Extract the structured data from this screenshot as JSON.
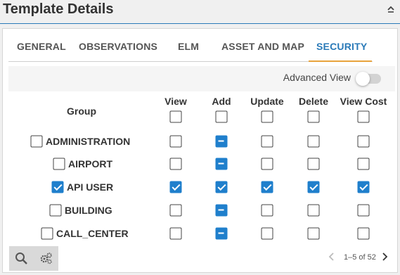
{
  "header": {
    "title": "Template Details",
    "collapse_icon": "chevron-up-icon"
  },
  "tabs": [
    {
      "label": "GENERAL",
      "active": false
    },
    {
      "label": "OBSERVATIONS",
      "active": false
    },
    {
      "label": "ELM",
      "active": false
    },
    {
      "label": "ASSET AND MAP",
      "active": false
    },
    {
      "label": "SECURITY",
      "active": true
    }
  ],
  "advanced_view": {
    "label": "Advanced View",
    "enabled": false
  },
  "table": {
    "group_header": "Group",
    "columns": [
      "View",
      "Add",
      "Update",
      "Delete",
      "View Cost"
    ],
    "header_checkboxes": [
      "unchecked",
      "unchecked",
      "unchecked",
      "unchecked",
      "unchecked"
    ],
    "rows": [
      {
        "label": "ADMINISTRATION",
        "row_checkbox": "unchecked",
        "cells": [
          "unchecked",
          "partial",
          "unchecked",
          "unchecked",
          "unchecked"
        ]
      },
      {
        "label": "AIRPORT",
        "row_checkbox": "unchecked",
        "cells": [
          "unchecked",
          "partial",
          "unchecked",
          "unchecked",
          "unchecked"
        ]
      },
      {
        "label": "API USER",
        "row_checkbox": "checked",
        "cells": [
          "checked",
          "checked",
          "checked",
          "checked",
          "checked"
        ]
      },
      {
        "label": "BUILDING",
        "row_checkbox": "unchecked",
        "cells": [
          "unchecked",
          "partial",
          "unchecked",
          "unchecked",
          "unchecked"
        ]
      },
      {
        "label": "CALL_CENTER",
        "row_checkbox": "unchecked",
        "cells": [
          "unchecked",
          "partial",
          "unchecked",
          "unchecked",
          "unchecked"
        ]
      }
    ]
  },
  "toolbar": {
    "search_icon": "search-icon",
    "settings_icon": "gears-icon"
  },
  "pager": {
    "text": "1–5 of 52"
  },
  "colors": {
    "accent": "#1f7fcc",
    "tab_active": "#2a7ab8",
    "tab_underline": "#e8a33c"
  }
}
